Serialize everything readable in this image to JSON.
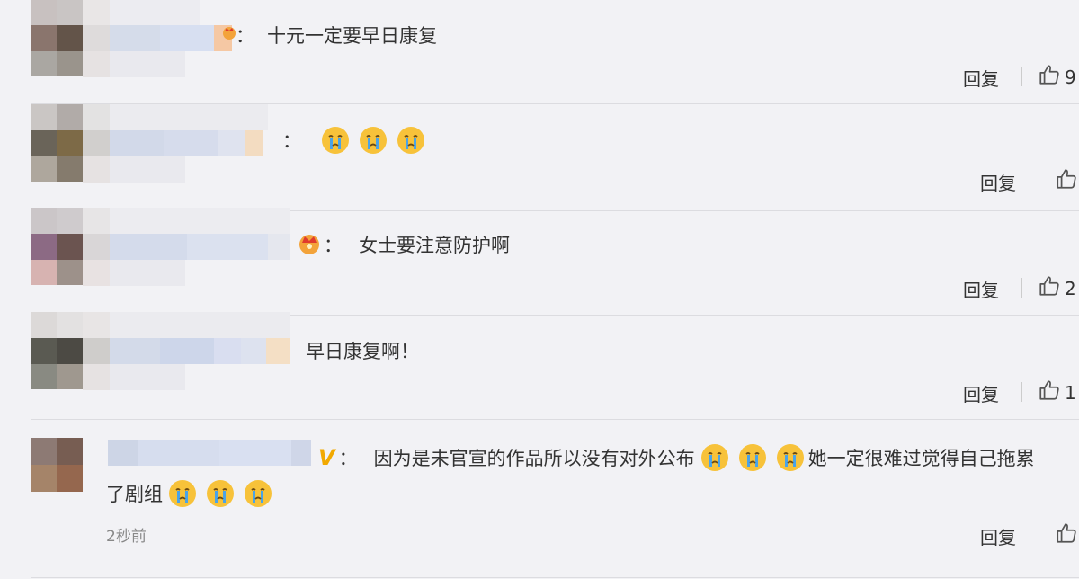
{
  "comments": [
    {
      "separator": "：",
      "text": "十元一定要早日康复",
      "reply_label": "回复",
      "like_count": "9"
    },
    {
      "separator": "：",
      "text": "",
      "reply_label": "回复",
      "like_count": ""
    },
    {
      "separator": "：",
      "text": "女士要注意防护啊",
      "reply_label": "回复",
      "like_count": "2"
    },
    {
      "separator": "",
      "text": "早日康复啊！",
      "reply_label": "回复",
      "like_count": "1"
    },
    {
      "separator": "：",
      "text_part1": "因为是未官宣的作品所以没有对外公布",
      "text_part2": "她一定很难过觉得自己拖累",
      "text_line2": "了剧组",
      "time": "2秒前",
      "reply_label": "回复",
      "like_count": ""
    }
  ],
  "icons": {
    "crying_emoji": "crying-emoji-icon",
    "crown_badge": "crown-icon",
    "verified_badge": "verified-v-icon",
    "thumbs_up": "thumbs-up-icon"
  },
  "colors": {
    "background": "#f2f2f5",
    "divider": "#dcdce0",
    "emoji_face": "#f7c23a",
    "tears": "#4aa3e8",
    "verified": "#f2a900"
  }
}
